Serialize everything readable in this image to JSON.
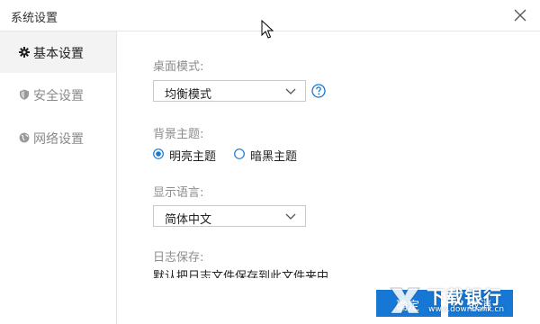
{
  "window": {
    "title": "系统设置"
  },
  "sidebar": {
    "items": [
      {
        "label": "基本设置",
        "icon": "gear-icon",
        "active": true
      },
      {
        "label": "安全设置",
        "icon": "shield-icon",
        "active": false
      },
      {
        "label": "网络设置",
        "icon": "globe-icon",
        "active": false
      }
    ]
  },
  "settings": {
    "desktop_mode": {
      "label": "桌面模式:",
      "value": "均衡模式"
    },
    "theme": {
      "label": "背景主题:",
      "options": [
        {
          "label": "明亮主题",
          "selected": true
        },
        {
          "label": "暗黑主题",
          "selected": false
        }
      ]
    },
    "language": {
      "label": "显示语言:",
      "value": "简体中文"
    },
    "log": {
      "label": "日志保存:",
      "text": "默认把日志文件保存到此文件夹中"
    }
  },
  "buttons": {
    "confirm": "确定",
    "cancel": "取消"
  },
  "colors": {
    "accent": "#1677d4"
  },
  "watermark": {
    "brand": "下载银行",
    "url": "www.downbank.cn"
  }
}
